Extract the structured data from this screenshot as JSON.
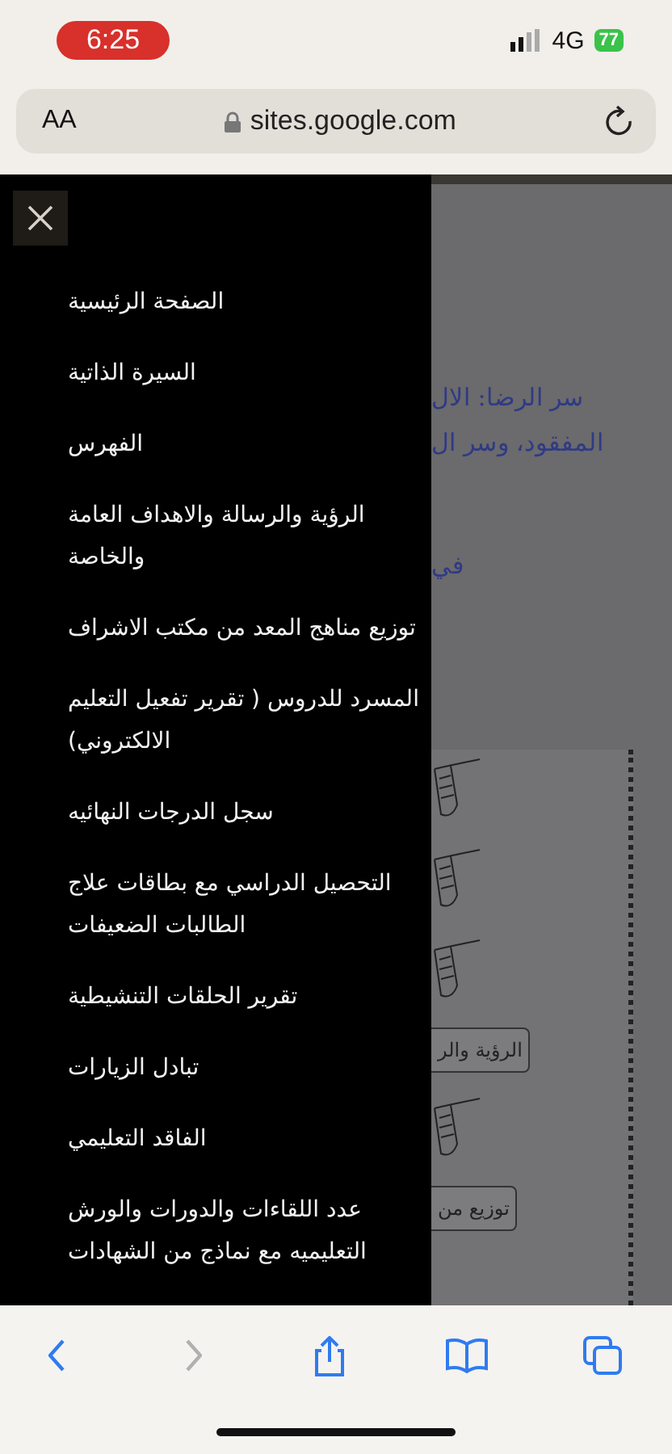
{
  "status_bar": {
    "time": "6:25",
    "network": "4G",
    "battery": "77"
  },
  "address_bar": {
    "text_size": "AA",
    "url": "sites.google.com"
  },
  "menu": {
    "items": [
      {
        "label": "الصفحة الرئيسية"
      },
      {
        "label": "السيرة الذاتية"
      },
      {
        "label": "الفهرس"
      },
      {
        "label": "الرؤية والرسالة والاهداف العامة والخاصة"
      },
      {
        "label": "توزيع مناهج المعد من مكتب الاشراف"
      },
      {
        "label": "المسرد للدروس ( تقرير تفعيل التعليم الالكتروني)"
      },
      {
        "label": "سجل الدرجات النهائيه"
      },
      {
        "label": "التحصيل الدراسي مع بطاقات علاج الطالبات الضعيفات"
      },
      {
        "label": "تقرير الحلقات التنشيطية"
      },
      {
        "label": "تبادل الزيارات"
      },
      {
        "label": "الفاقد التعليمي"
      },
      {
        "label": "عدد اللقاءات والدورات والورش التعليميه مع نماذج من الشهادات"
      }
    ]
  },
  "page": {
    "lines": [
      "سر الرضا: الال",
      "المفقود، وسر ال",
      "في"
    ],
    "buttons": [
      {
        "label": "الرؤية والر"
      },
      {
        "label": "توزيع من"
      }
    ]
  },
  "toolbar": {
    "buttons": [
      {
        "kind": "back",
        "disabled": false
      },
      {
        "kind": "forward",
        "disabled": true
      },
      {
        "kind": "share",
        "disabled": false
      },
      {
        "kind": "bookmarks",
        "disabled": false
      },
      {
        "kind": "tabs",
        "disabled": false
      }
    ]
  }
}
